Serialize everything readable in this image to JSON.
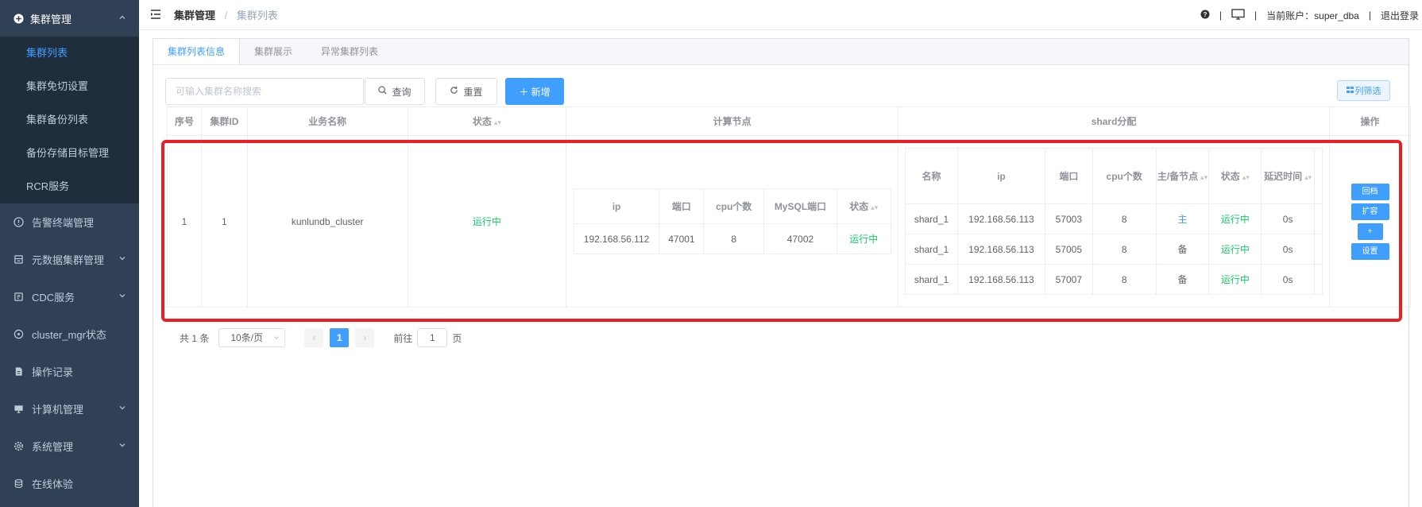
{
  "sidebar": {
    "group": {
      "label": "集群管理",
      "icon": "plus-circle-icon"
    },
    "sub_items": [
      "集群列表",
      "集群免切设置",
      "集群备份列表",
      "备份存储目标管理",
      "RCR服务"
    ],
    "items": [
      {
        "label": "告警终端管理",
        "icon": "info-circle-icon",
        "has_chevron": false
      },
      {
        "label": "元数据集群管理",
        "icon": "database-icon",
        "has_chevron": true
      },
      {
        "label": "CDC服务",
        "icon": "cdc-icon",
        "has_chevron": true
      },
      {
        "label": "cluster_mgr状态",
        "icon": "network-icon",
        "has_chevron": false
      },
      {
        "label": "操作记录",
        "icon": "document-icon",
        "has_chevron": false
      },
      {
        "label": "计算机管理",
        "icon": "computer-icon",
        "has_chevron": true
      },
      {
        "label": "系统管理",
        "icon": "gear-icon",
        "has_chevron": true
      },
      {
        "label": "在线体验",
        "icon": "database-icon",
        "has_chevron": false
      }
    ]
  },
  "navbar": {
    "breadcrumb": [
      "集群管理",
      "集群列表"
    ],
    "account_label": "当前账户：super_dba",
    "logout": "退出登录",
    "sep": "|"
  },
  "tabs": [
    "集群列表信息",
    "集群展示",
    "异常集群列表"
  ],
  "toolbar": {
    "search_placeholder": "可输入集群名称搜索",
    "query": "查询",
    "reset": "重置",
    "add": "＋ 新增",
    "column_filter": "列筛选"
  },
  "table": {
    "headers": {
      "index": "序号",
      "id": "集群ID",
      "name": "业务名称",
      "status": "状态",
      "compute": "计算节点",
      "shard": "shard分配",
      "ops": "操作"
    },
    "row": {
      "index": "1",
      "id": "1",
      "name": "kunlundb_cluster",
      "status": "运行中"
    },
    "compute_headers": [
      "ip",
      "端口",
      "cpu个数",
      "MySQL端口",
      "状态"
    ],
    "compute_rows": [
      [
        "192.168.56.112",
        "47001",
        "8",
        "47002",
        "运行中"
      ]
    ],
    "shard_headers": {
      "name": "名称",
      "ip": "ip",
      "port": "端口",
      "cpu": "cpu个数",
      "role": "主/备节点",
      "status": "状态",
      "delay": "延迟时间"
    },
    "shard_rows": [
      [
        "shard_1",
        "192.168.56.113",
        "57003",
        "8",
        "主",
        "运行中",
        "0s"
      ],
      [
        "shard_1",
        "192.168.56.113",
        "57005",
        "8",
        "备",
        "运行中",
        "0s"
      ],
      [
        "shard_1",
        "192.168.56.113",
        "57007",
        "8",
        "备",
        "运行中",
        "0s"
      ]
    ],
    "ops": [
      "回档",
      "扩容",
      "+",
      "设置"
    ]
  },
  "pager": {
    "total": "共 1 条",
    "size": "10条/页",
    "page": "1",
    "goto_pre": "前往",
    "goto_val": "1",
    "goto_post": "页"
  },
  "colors": {
    "accent": "#409eff",
    "green": "#13ce66",
    "sidebar": "#304156",
    "highlight": "#ee1c25"
  }
}
